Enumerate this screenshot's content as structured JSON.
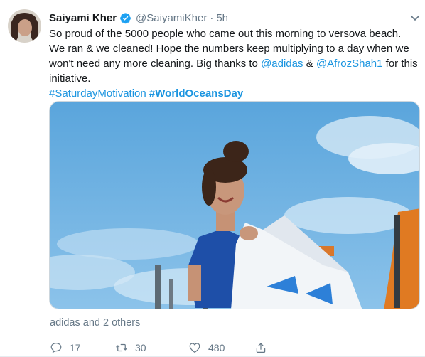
{
  "tweet": {
    "author_name": "Saiyami Kher",
    "handle": "@SaiyamiKher",
    "separator": "·",
    "time": "5h",
    "text_lines": [
      "So proud of the 5000 people who came out this morning to versova beach.",
      "We ran & we cleaned! Hope the numbers keep multiplying to a day when we",
      "won't need any more cleaning. Big thanks to",
      "initiative."
    ],
    "mention_1": "@adidas",
    "connector": "&",
    "mention_2": "@AfrozShah1",
    "after_mentions": "for this",
    "hashtag_1": "#SaturdayMotivation",
    "hashtag_2": "#WorldOceansDay",
    "liked_by": "adidas and 2 others",
    "reply_count": "17",
    "retweet_count": "30",
    "like_count": "480",
    "icons": [
      "verified-badge-icon",
      "chevron-down-icon",
      "reply-icon",
      "retweet-icon",
      "heart-icon",
      "share-icon"
    ],
    "colors": {
      "link": "#1b95e0",
      "secondary": "#657786",
      "verified": "#1da1f2"
    }
  }
}
